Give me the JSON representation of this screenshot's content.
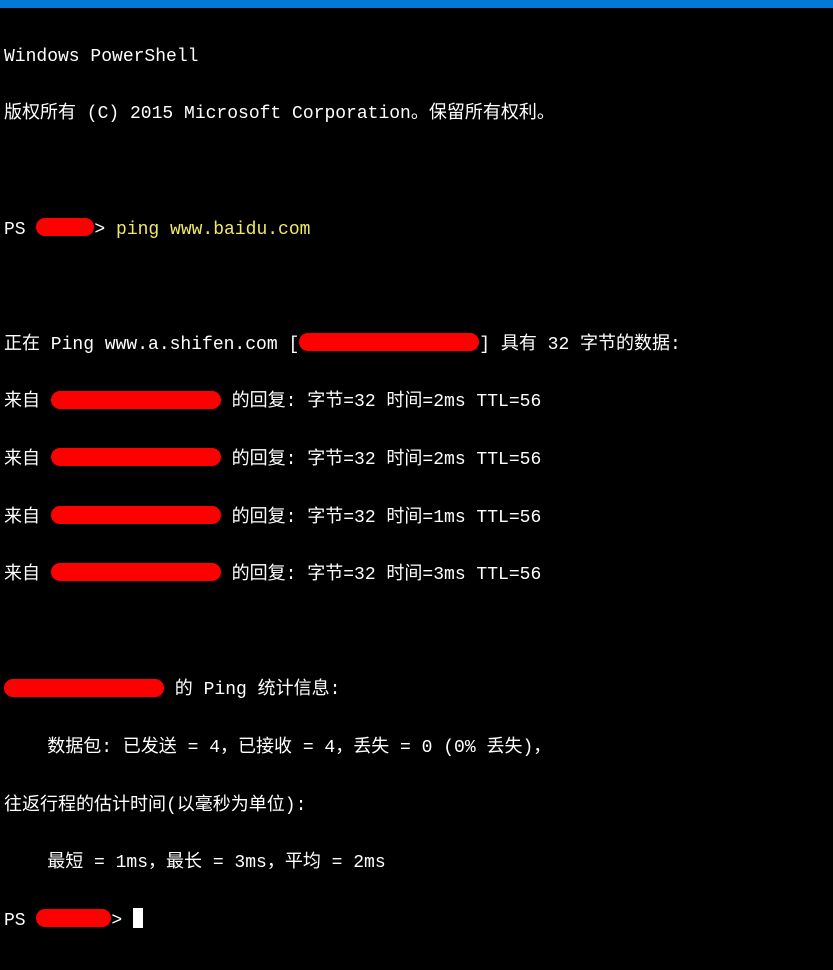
{
  "header": {
    "title": "Windows PowerShell",
    "copyright": "版权所有 (C) 2015 Microsoft Corporation。保留所有权利。"
  },
  "prompt1": {
    "prefix": "PS ",
    "suffix": "> ",
    "command": "ping www.baidu.com"
  },
  "ping_header": {
    "prefix": "正在 Ping www.a.shifen.com [",
    "suffix": "] 具有 32 字节的数据:"
  },
  "replies": [
    {
      "prefix": "来自 ",
      "suffix": " 的回复: 字节=32 时间=2ms TTL=56"
    },
    {
      "prefix": "来自 ",
      "suffix": " 的回复: 字节=32 时间=2ms TTL=56"
    },
    {
      "prefix": "来自 ",
      "suffix": " 的回复: 字节=32 时间=1ms TTL=56"
    },
    {
      "prefix": "来自 ",
      "suffix": " 的回复: 字节=32 时间=3ms TTL=56"
    }
  ],
  "stats": {
    "header_suffix": " 的 Ping 统计信息:",
    "packets": "    数据包: 已发送 = 4，已接收 = 4，丢失 = 0 (0% 丢失)，",
    "rtt_header": "往返行程的估计时间(以毫秒为单位):",
    "rtt_values": "    最短 = 1ms，最长 = 3ms，平均 = 2ms"
  },
  "prompt2": {
    "prefix": "PS ",
    "suffix": "> "
  }
}
